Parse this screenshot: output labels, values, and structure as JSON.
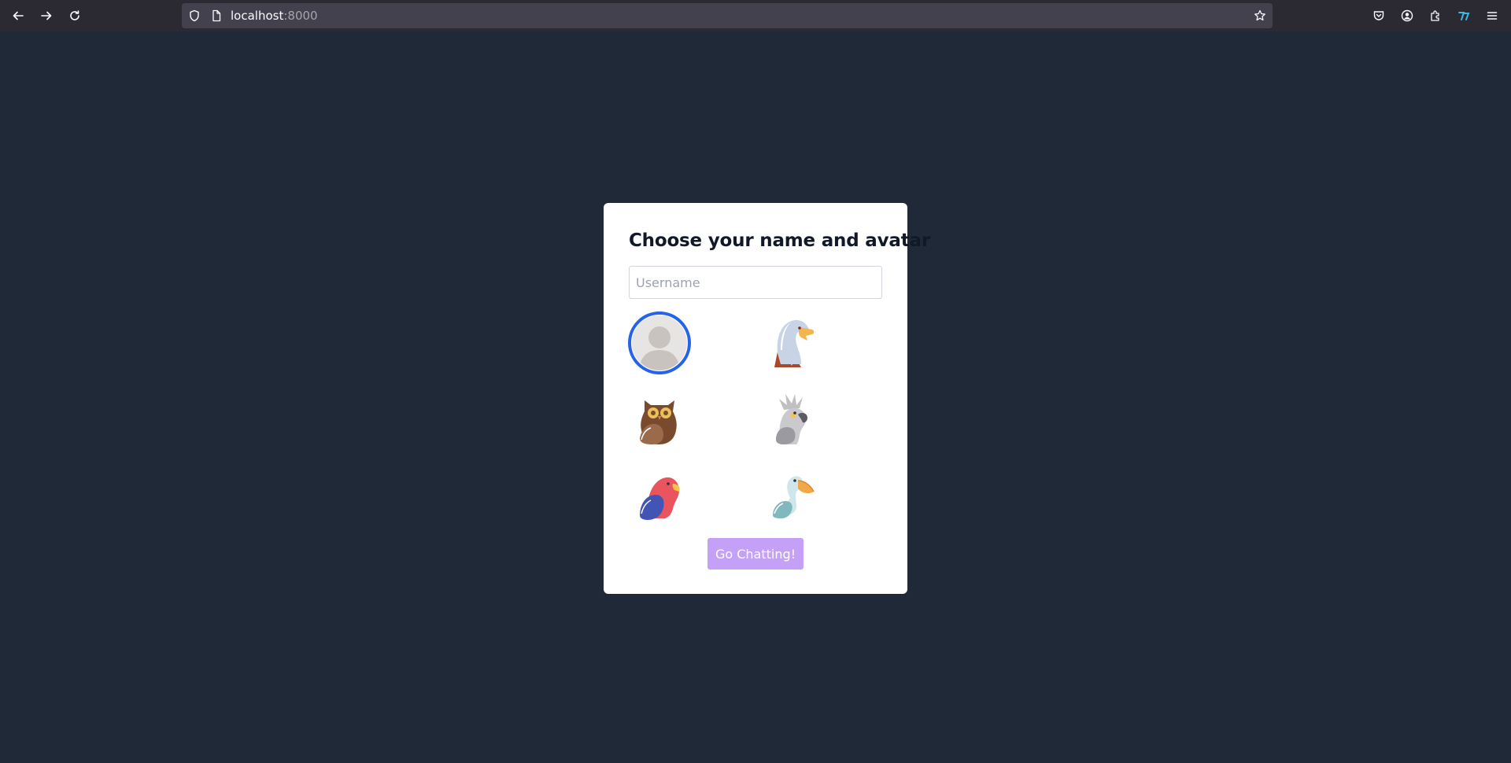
{
  "browser": {
    "url_host": "localhost",
    "url_port": ":8000",
    "icons": [
      "back-icon",
      "forward-icon",
      "reload-icon",
      "shield-icon",
      "page-icon",
      "bookmark-star-icon",
      "pocket-icon",
      "account-icon",
      "extensions-icon",
      "extension-app-icon",
      "menu-icon"
    ]
  },
  "card": {
    "title": "Choose your name and avatar",
    "username_placeholder": "Username",
    "username_value": "",
    "submit_label": "Go Chatting!",
    "submit_color": "#c4a1f7",
    "selected_ring_color": "#2563eb"
  },
  "avatars": [
    {
      "name": "default-person",
      "selected": true
    },
    {
      "name": "eagle",
      "selected": false
    },
    {
      "name": "owl",
      "selected": false
    },
    {
      "name": "cockatoo",
      "selected": false
    },
    {
      "name": "parrot",
      "selected": false
    },
    {
      "name": "pelican",
      "selected": false
    }
  ],
  "colors": {
    "page_background": "#1f2937",
    "toolbar": "#2b2a33",
    "urlbar": "#42414d"
  }
}
